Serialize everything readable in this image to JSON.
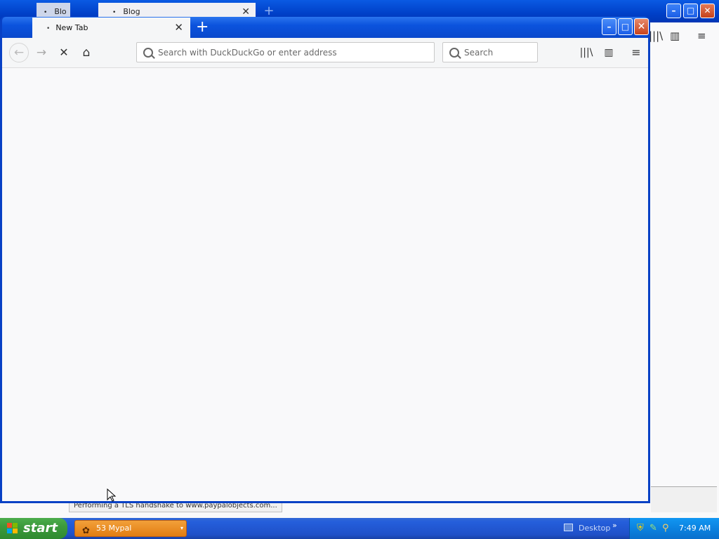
{
  "background_window": {
    "tabs": [
      {
        "label": "Blo"
      },
      {
        "label": "Blog"
      }
    ],
    "new_tab_glyph": "+",
    "controls": {
      "minimize": "–",
      "maximize": "□",
      "close": "✕"
    },
    "toolbar_icons": [
      "library-icon",
      "sidebar-icon",
      "menu-icon"
    ]
  },
  "status_bar": {
    "text": "Performing a TLS handshake to www.paypalobjects.com..."
  },
  "browser": {
    "tab": {
      "label": "New Tab",
      "close_glyph": "✕"
    },
    "new_tab_glyph": "+",
    "controls": {
      "minimize": "–",
      "maximize": "□",
      "close": "✕"
    },
    "toolbar": {
      "back_glyph": "←",
      "forward_glyph": "→",
      "stop_glyph": "✕",
      "home_glyph": "⌂",
      "library_glyph": "|||\\",
      "sidebar_glyph": "▥",
      "menu_glyph": "≡"
    },
    "url_placeholder": "Search with DuckDuckGo or enter address",
    "search_placeholder": "Search"
  },
  "taskbar": {
    "start_label": "start",
    "task": {
      "label": "53 Mypal",
      "arrow": "▾"
    },
    "desktop_label": "Desktop",
    "desktop_more": "»",
    "clock": "7:49 AM"
  },
  "colors": {
    "title_blue": "#0a4fd8",
    "taskbar_blue": "#245edb",
    "start_green": "#3c9a3c",
    "task_orange": "#e27d12",
    "tray_blue": "#0b82e0",
    "close_red": "#c8431c"
  }
}
